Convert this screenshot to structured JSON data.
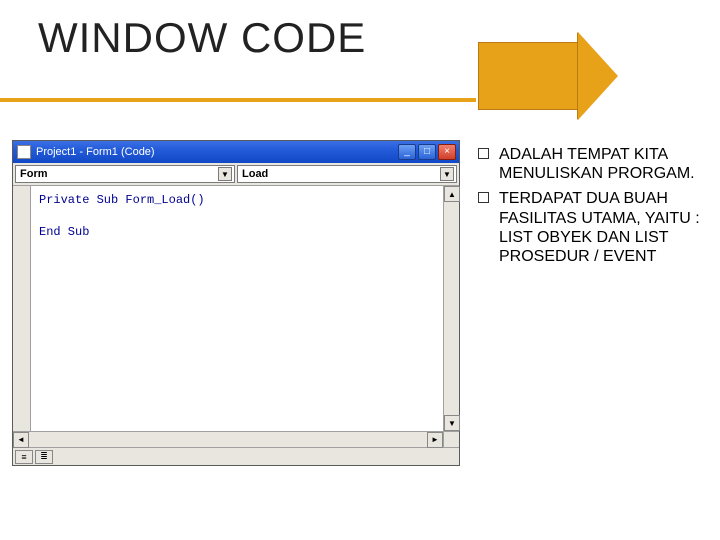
{
  "title": "WINDOW CODE",
  "window": {
    "title": "Project1 - Form1 (Code)",
    "object_combo": "Form",
    "proc_combo": "Load",
    "code_line1": "Private Sub Form_Load()",
    "code_line2": "End Sub"
  },
  "bullets": [
    "ADALAH TEMPAT KITA MENULISKAN PRORGAM.",
    "TERDAPAT DUA BUAH FASILITAS UTAMA, YAITU : LIST OBYEK DAN LIST PROSEDUR / EVENT"
  ]
}
